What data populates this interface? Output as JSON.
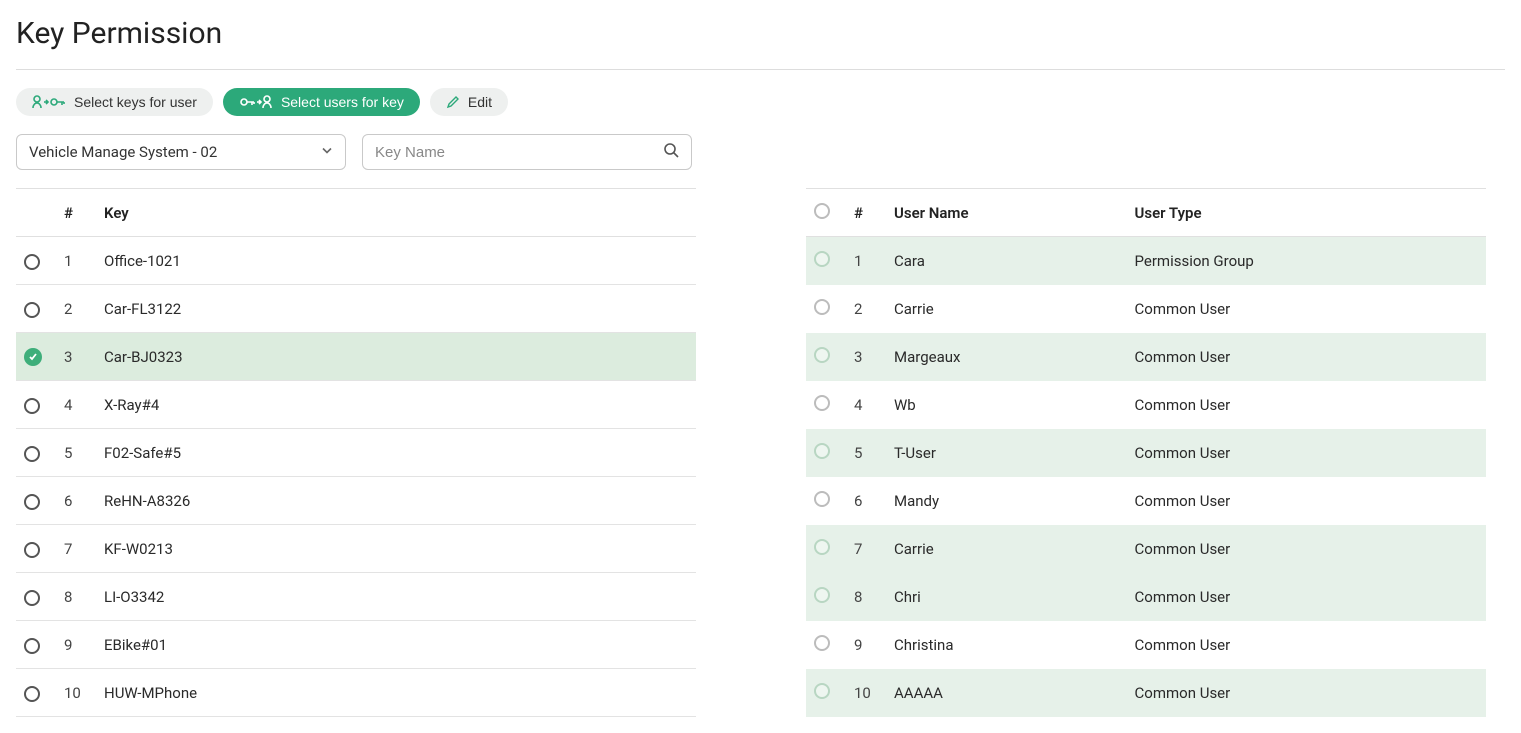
{
  "page": {
    "title": "Key Permission"
  },
  "toolbar": {
    "select_keys_label": "Select keys for user",
    "select_users_label": "Select users for key",
    "edit_label": "Edit"
  },
  "filters": {
    "system_selected": "Vehicle Manage System - 02",
    "search_placeholder": "Key Name"
  },
  "keys_table": {
    "headers": {
      "num": "#",
      "key": "Key"
    },
    "rows": [
      {
        "num": "1",
        "key": "Office-1021",
        "selected": false
      },
      {
        "num": "2",
        "key": "Car-FL3122",
        "selected": false
      },
      {
        "num": "3",
        "key": "Car-BJ0323",
        "selected": true
      },
      {
        "num": "4",
        "key": "X-Ray#4",
        "selected": false
      },
      {
        "num": "5",
        "key": "F02-Safe#5",
        "selected": false
      },
      {
        "num": "6",
        "key": "ReHN-A8326",
        "selected": false
      },
      {
        "num": "7",
        "key": "KF-W0213",
        "selected": false
      },
      {
        "num": "8",
        "key": "LI-O3342",
        "selected": false
      },
      {
        "num": "9",
        "key": "EBike#01",
        "selected": false
      },
      {
        "num": "10",
        "key": "HUW-MPhone",
        "selected": false
      }
    ]
  },
  "users_table": {
    "headers": {
      "num": "#",
      "name": "User Name",
      "type": "User Type"
    },
    "rows": [
      {
        "num": "1",
        "name": "Cara",
        "type": "Permission Group",
        "alt": true
      },
      {
        "num": "2",
        "name": "Carrie",
        "type": "Common User",
        "alt": false
      },
      {
        "num": "3",
        "name": "Margeaux",
        "type": "Common User",
        "alt": true
      },
      {
        "num": "4",
        "name": "Wb",
        "type": "Common User",
        "alt": false
      },
      {
        "num": "5",
        "name": "T-User",
        "type": "Common User",
        "alt": true
      },
      {
        "num": "6",
        "name": "Mandy",
        "type": "Common User",
        "alt": false
      },
      {
        "num": "7",
        "name": "Carrie",
        "type": "Common User",
        "alt": true
      },
      {
        "num": "8",
        "name": "Chri",
        "type": "Common User",
        "alt": true
      },
      {
        "num": "9",
        "name": "Christina",
        "type": "Common User",
        "alt": false
      },
      {
        "num": "10",
        "name": "AAAAA",
        "type": "Common User",
        "alt": true
      }
    ]
  }
}
